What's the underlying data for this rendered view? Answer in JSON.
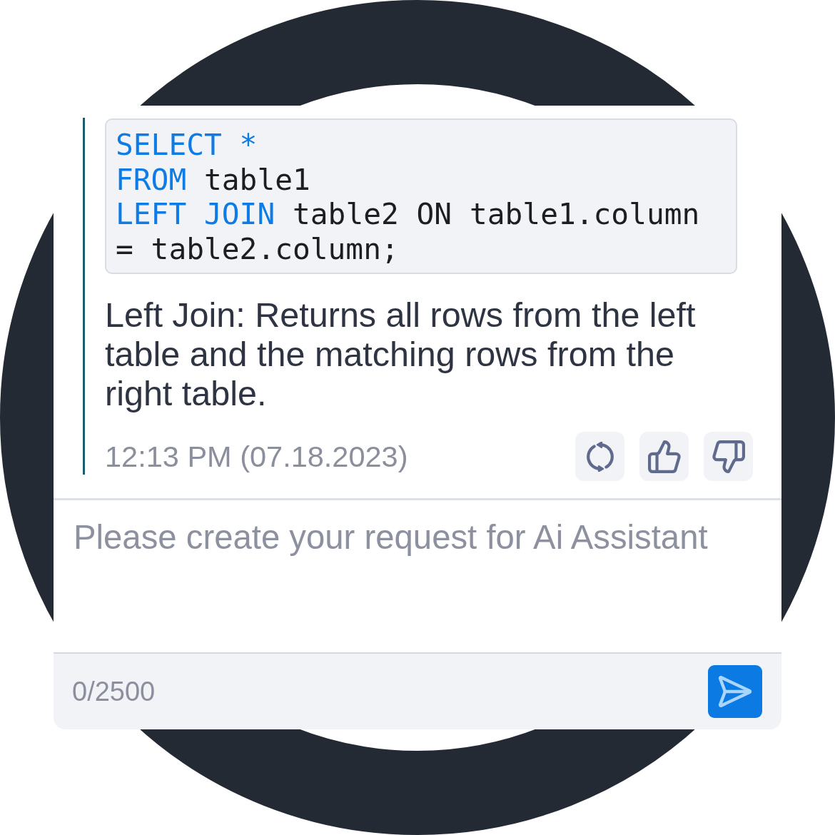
{
  "message": {
    "code_lines": [
      [
        {
          "text": "SELECT *",
          "kind": "keyword"
        }
      ],
      [
        {
          "text": "FROM",
          "kind": "keyword"
        },
        {
          "text": " table1",
          "kind": "plain"
        }
      ],
      [
        {
          "text": "LEFT JOIN",
          "kind": "keyword"
        },
        {
          "text": " table2 ON table1.column",
          "kind": "plain"
        }
      ],
      [
        {
          "text": "= table2.column;",
          "kind": "plain"
        }
      ]
    ],
    "text": "Left Join: Returns all rows from the left table and the matching rows from the right table.",
    "timestamp": "12:13 PM (07.18.2023)"
  },
  "composer": {
    "placeholder": "Please create your request for Ai Assistant",
    "counter": "0/2500"
  }
}
